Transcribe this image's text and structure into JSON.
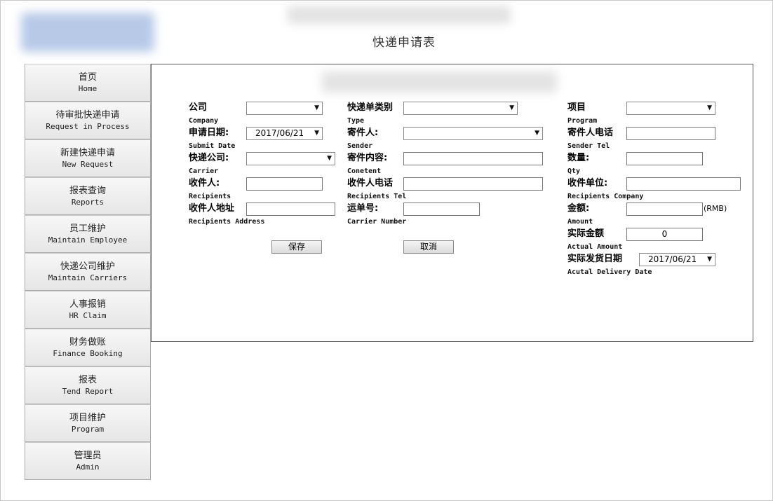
{
  "page_title": "快递申请表",
  "sidebar": {
    "items": [
      {
        "cn": "首页",
        "en": "Home"
      },
      {
        "cn": "待审批快递申请",
        "en": "Request in Process"
      },
      {
        "cn": "新建快递申请",
        "en": "New Request"
      },
      {
        "cn": "报表查询",
        "en": "Reports"
      },
      {
        "cn": "员工维护",
        "en": "Maintain Employee"
      },
      {
        "cn": "快递公司维护",
        "en": "Maintain Carriers"
      },
      {
        "cn": "人事报销",
        "en": "HR Claim"
      },
      {
        "cn": "财务做账",
        "en": "Finance Booking"
      },
      {
        "cn": "报表",
        "en": "Tend Report"
      },
      {
        "cn": "项目维护",
        "en": "Program"
      },
      {
        "cn": "管理员",
        "en": "Admin"
      }
    ]
  },
  "form": {
    "company": {
      "label": "公司",
      "sub": "Company",
      "value": ""
    },
    "submit_date": {
      "label": "申请日期:",
      "sub": "Submit Date",
      "value": "2017/06/21"
    },
    "carrier": {
      "label": "快递公司:",
      "sub": "Carrier",
      "value": ""
    },
    "recipients": {
      "label": "收件人:",
      "sub": "Recipients",
      "value": ""
    },
    "recipients_address": {
      "label": "收件人地址",
      "sub": "Recipients Address",
      "value": ""
    },
    "type": {
      "label": "快递单类别",
      "sub": "Type",
      "value": ""
    },
    "sender": {
      "label": "寄件人:",
      "sub": "Sender",
      "value": ""
    },
    "content": {
      "label": "寄件内容:",
      "sub": "Conetent",
      "value": ""
    },
    "recipients_tel": {
      "label": "收件人电话",
      "sub": "Recipients Tel",
      "value": ""
    },
    "carrier_number": {
      "label": "运单号:",
      "sub": "Carrier Number",
      "value": ""
    },
    "program": {
      "label": "项目",
      "sub": "Program",
      "value": ""
    },
    "sender_tel": {
      "label": "寄件人电话",
      "sub": "Sender Tel",
      "value": ""
    },
    "qty": {
      "label": "数量:",
      "sub": "Qty",
      "value": ""
    },
    "recipients_company": {
      "label": "收件单位:",
      "sub": "Recipients Company",
      "value": ""
    },
    "amount": {
      "label": "金额:",
      "sub": "Amount",
      "value": "",
      "unit": "(RMB)"
    },
    "actual_amount": {
      "label": "实际金额",
      "sub": "Actual Amount",
      "value": "0"
    },
    "delivery_date": {
      "label": "实际发货日期",
      "sub": "Acutal Delivery Date",
      "value": "2017/06/21"
    },
    "save_label": "保存",
    "cancel_label": "取消"
  },
  "icons": {
    "dropdown": "chevron-down-icon"
  }
}
